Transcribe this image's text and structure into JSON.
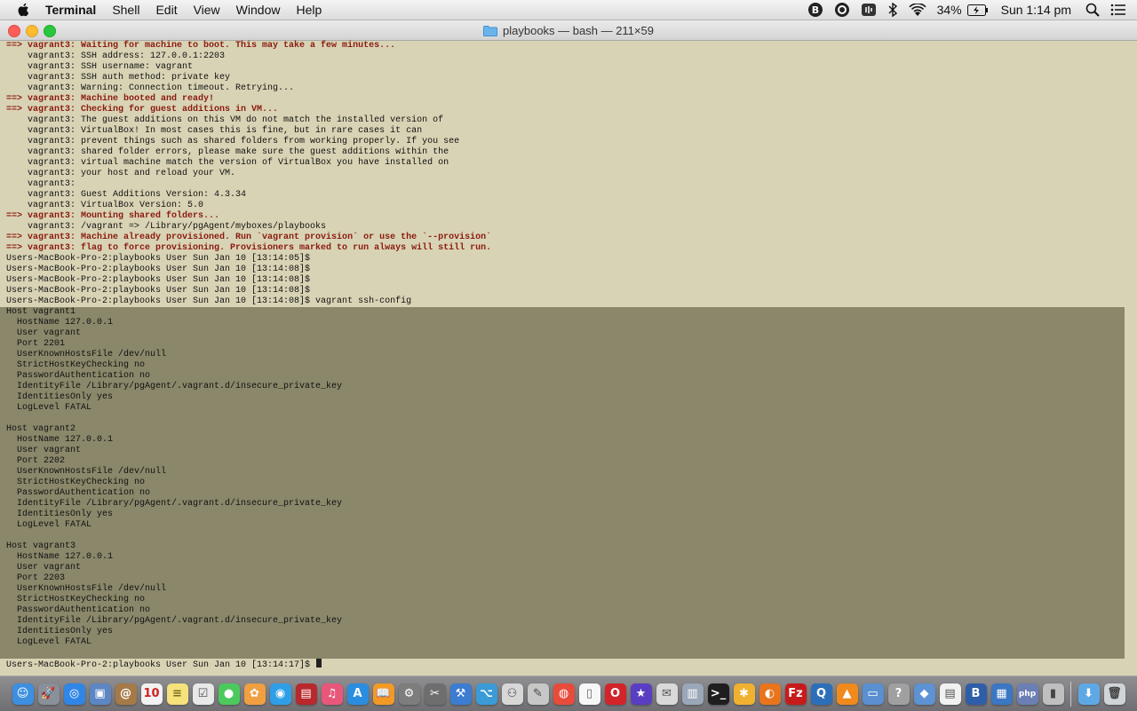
{
  "menubar": {
    "app_name": "Terminal",
    "menus": [
      "Shell",
      "Edit",
      "View",
      "Window",
      "Help"
    ],
    "battery_percent": "34%",
    "clock": "Sun 1:14 pm",
    "status_icons": [
      "bitbucket-icon",
      "circle-a-icon",
      "audio-icon",
      "bluetooth-icon",
      "wifi-icon",
      "battery-icon",
      "spotlight-search-icon",
      "notification-list-icon"
    ]
  },
  "window": {
    "title": "playbooks — bash — 211×59"
  },
  "terminal": {
    "lines": [
      {
        "t": "==> vagrant3: Waiting for machine to boot. This may take a few minutes...",
        "s": "hdr"
      },
      {
        "t": "    vagrant3: SSH address: 127.0.0.1:2203",
        "s": ""
      },
      {
        "t": "    vagrant3: SSH username: vagrant",
        "s": ""
      },
      {
        "t": "    vagrant3: SSH auth method: private key",
        "s": ""
      },
      {
        "t": "    vagrant3: Warning: Connection timeout. Retrying...",
        "s": ""
      },
      {
        "t": "==> vagrant3: Machine booted and ready!",
        "s": "hdr"
      },
      {
        "t": "==> vagrant3: Checking for guest additions in VM...",
        "s": "hdr"
      },
      {
        "t": "    vagrant3: The guest additions on this VM do not match the installed version of",
        "s": ""
      },
      {
        "t": "    vagrant3: VirtualBox! In most cases this is fine, but in rare cases it can",
        "s": ""
      },
      {
        "t": "    vagrant3: prevent things such as shared folders from working properly. If you see",
        "s": ""
      },
      {
        "t": "    vagrant3: shared folder errors, please make sure the guest additions within the",
        "s": ""
      },
      {
        "t": "    vagrant3: virtual machine match the version of VirtualBox you have installed on",
        "s": ""
      },
      {
        "t": "    vagrant3: your host and reload your VM.",
        "s": ""
      },
      {
        "t": "    vagrant3:",
        "s": ""
      },
      {
        "t": "    vagrant3: Guest Additions Version: 4.3.34",
        "s": ""
      },
      {
        "t": "    vagrant3: VirtualBox Version: 5.0",
        "s": ""
      },
      {
        "t": "==> vagrant3: Mounting shared folders...",
        "s": "hdr"
      },
      {
        "t": "    vagrant3: /vagrant => /Library/pgAgent/myboxes/playbooks",
        "s": ""
      },
      {
        "t": "==> vagrant3: Machine already provisioned. Run `vagrant provision` or use the `--provision`",
        "s": "hdr"
      },
      {
        "t": "==> vagrant3: flag to force provisioning. Provisioners marked to run always will still run.",
        "s": "hdr"
      },
      {
        "t": "Users-MacBook-Pro-2:playbooks User Sun Jan 10 [13:14:05]$",
        "s": ""
      },
      {
        "t": "Users-MacBook-Pro-2:playbooks User Sun Jan 10 [13:14:08]$",
        "s": ""
      },
      {
        "t": "Users-MacBook-Pro-2:playbooks User Sun Jan 10 [13:14:08]$",
        "s": ""
      },
      {
        "t": "Users-MacBook-Pro-2:playbooks User Sun Jan 10 [13:14:08]$",
        "s": ""
      },
      {
        "t": "Users-MacBook-Pro-2:playbooks User Sun Jan 10 [13:14:08]$ vagrant ssh-config",
        "s": ""
      }
    ],
    "selected_lines": [
      "Host vagrant1",
      "  HostName 127.0.0.1",
      "  User vagrant",
      "  Port 2201",
      "  UserKnownHostsFile /dev/null",
      "  StrictHostKeyChecking no",
      "  PasswordAuthentication no",
      "  IdentityFile /Library/pgAgent/.vagrant.d/insecure_private_key",
      "  IdentitiesOnly yes",
      "  LogLevel FATAL",
      "",
      "Host vagrant2",
      "  HostName 127.0.0.1",
      "  User vagrant",
      "  Port 2202",
      "  UserKnownHostsFile /dev/null",
      "  StrictHostKeyChecking no",
      "  PasswordAuthentication no",
      "  IdentityFile /Library/pgAgent/.vagrant.d/insecure_private_key",
      "  IdentitiesOnly yes",
      "  LogLevel FATAL",
      "",
      "Host vagrant3",
      "  HostName 127.0.0.1",
      "  User vagrant",
      "  Port 2203",
      "  UserKnownHostsFile /dev/null",
      "  StrictHostKeyChecking no",
      "  PasswordAuthentication no",
      "  IdentityFile /Library/pgAgent/.vagrant.d/insecure_private_key",
      "  IdentitiesOnly yes",
      "  LogLevel FATAL",
      ""
    ],
    "prompt": "Users-MacBook-Pro-2:playbooks User Sun Jan 10 [13:14:17]$ ",
    "colors": {
      "background": "#d8d3b4",
      "selection": "#8a876a",
      "header_text": "#8b1a10"
    }
  },
  "dock": {
    "apps": [
      {
        "name": "finder-icon",
        "color": "#3d8fe0",
        "glyph": "☺"
      },
      {
        "name": "launchpad-icon",
        "color": "#8a8f99",
        "glyph": "🚀"
      },
      {
        "name": "safari-icon",
        "color": "#2f86e6",
        "glyph": "◎"
      },
      {
        "name": "preview-icon",
        "color": "#5c86c4",
        "glyph": "▣"
      },
      {
        "name": "contacts-icon",
        "color": "#a57a47",
        "glyph": "@"
      },
      {
        "name": "calendar-icon",
        "color": "#f2f2f2",
        "glyph": "10",
        "fg": "#c22"
      },
      {
        "name": "notes-icon",
        "color": "#f5e27a",
        "glyph": "≡",
        "fg": "#7a6a20"
      },
      {
        "name": "reminders-icon",
        "color": "#e8e8e8",
        "glyph": "☑",
        "fg": "#555"
      },
      {
        "name": "messages-icon",
        "color": "#4cc95d",
        "glyph": "●"
      },
      {
        "name": "photos-icon",
        "color": "#f0a040",
        "glyph": "✿"
      },
      {
        "name": "facetime-icon",
        "color": "#2e9fe6",
        "glyph": "◉"
      },
      {
        "name": "photo-booth-icon",
        "color": "#b8282c",
        "glyph": "▤"
      },
      {
        "name": "itunes-icon",
        "color": "#e8577a",
        "glyph": "♫"
      },
      {
        "name": "app-store-icon",
        "color": "#2b8de0",
        "glyph": "A"
      },
      {
        "name": "ibooks-icon",
        "color": "#f29a25",
        "glyph": "📖"
      },
      {
        "name": "system-preferences-icon",
        "color": "#7d7d7d",
        "glyph": "⚙"
      },
      {
        "name": "utility-icon",
        "color": "#6e6e6e",
        "glyph": "✂"
      },
      {
        "name": "xcode-icon",
        "color": "#3c7cd1",
        "glyph": "⚒"
      },
      {
        "name": "sourcetree-icon",
        "color": "#3b9bd6",
        "glyph": "⌥"
      },
      {
        "name": "network-icon",
        "color": "#d7d7d7",
        "glyph": "⚇",
        "fg": "#444"
      },
      {
        "name": "script-editor-icon",
        "color": "#c7c7c7",
        "glyph": "✎",
        "fg": "#444"
      },
      {
        "name": "chrome-icon",
        "color": "#e84b3b",
        "glyph": "◍"
      },
      {
        "name": "textedit-icon",
        "color": "#f7f7f7",
        "glyph": "▯",
        "fg": "#666"
      },
      {
        "name": "opera-icon",
        "color": "#d3242a",
        "glyph": "O"
      },
      {
        "name": "imovie-icon",
        "color": "#5a3ec2",
        "glyph": "★"
      },
      {
        "name": "mail-icon",
        "color": "#d9d9d9",
        "glyph": "✉",
        "fg": "#555"
      },
      {
        "name": "image-capture-icon",
        "color": "#9aa7b8",
        "glyph": "▥"
      },
      {
        "name": "terminal-icon",
        "color": "#1e1e1e",
        "glyph": ">_"
      },
      {
        "name": "plugin-icon",
        "color": "#f0b030",
        "glyph": "✱"
      },
      {
        "name": "firefox-icon",
        "color": "#e8741c",
        "glyph": "◐"
      },
      {
        "name": "filezilla-icon",
        "color": "#c71b1b",
        "glyph": "Fz"
      },
      {
        "name": "quicktime-icon",
        "color": "#2c6fb8",
        "glyph": "Q"
      },
      {
        "name": "vlc-icon",
        "color": "#f08a1c",
        "glyph": "▲"
      },
      {
        "name": "screen-sharing-icon",
        "color": "#5a8fd0",
        "glyph": "▭"
      },
      {
        "name": "help-icon",
        "color": "#a0a0a0",
        "glyph": "?"
      },
      {
        "name": "virtualbox-icon",
        "color": "#5d92d3",
        "glyph": "◆"
      },
      {
        "name": "document-icon",
        "color": "#f1f1f1",
        "glyph": "▤",
        "fg": "#555"
      },
      {
        "name": "bbedit-icon",
        "color": "#2f5ea8",
        "glyph": "B"
      },
      {
        "name": "virtualbox-vm-icon",
        "color": "#3b77c2",
        "glyph": "▦"
      },
      {
        "name": "php-icon",
        "color": "#6b7fb5",
        "glyph": "php"
      },
      {
        "name": "android-file-icon",
        "color": "#bfbfbf",
        "glyph": "▮",
        "fg": "#444"
      }
    ],
    "trailing": [
      {
        "name": "downloads-folder-icon",
        "color": "#5fa8e6",
        "glyph": "⬇"
      },
      {
        "name": "trash-icon",
        "color": "#cfd4d8",
        "glyph": "🗑",
        "fg": "#444"
      }
    ]
  }
}
